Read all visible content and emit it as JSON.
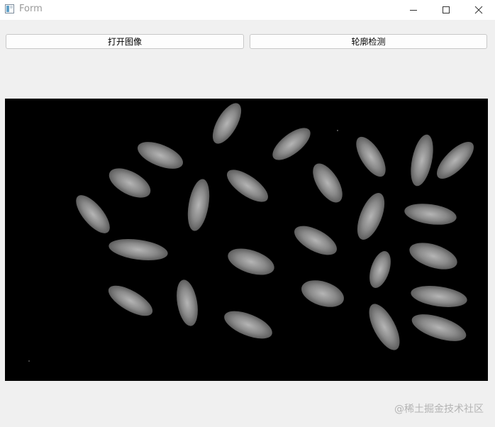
{
  "window": {
    "title": "Form",
    "icon": "app-window-icon"
  },
  "controls": {
    "minimize_icon": "minimize-icon",
    "maximize_icon": "maximize-icon",
    "close_icon": "close-icon"
  },
  "toolbar": {
    "open_image_label": "打开图像",
    "contour_detect_label": "轮廓检测"
  },
  "image_view": {
    "content": "rice grains on black background"
  },
  "watermark": {
    "text": "@稀土掘金技术社区"
  },
  "colors": {
    "titlebar": "#ffffff",
    "window_bg": "#f0f0f0",
    "image_bg": "#000000",
    "grain": "#8c8c8c"
  }
}
